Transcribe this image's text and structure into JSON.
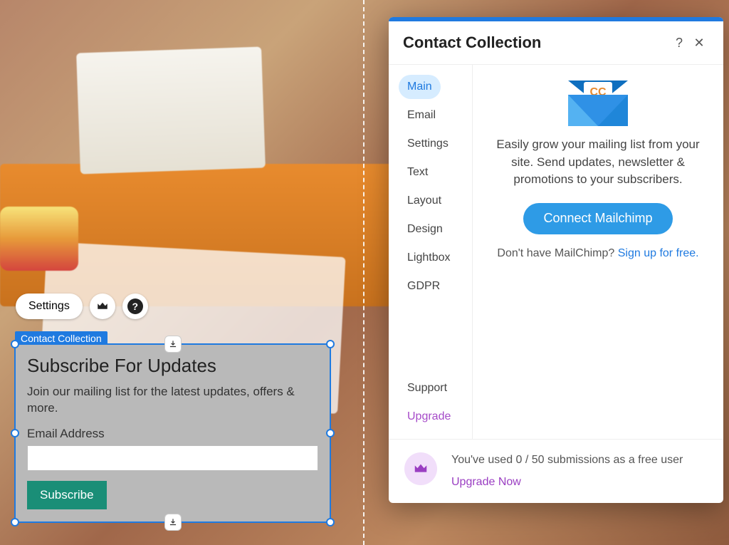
{
  "toolbar": {
    "settings_label": "Settings"
  },
  "widget": {
    "tag": "Contact Collection",
    "title": "Subscribe For Updates",
    "description": "Join our mailing list for the latest updates, offers & more.",
    "email_label": "Email Address",
    "email_value": "",
    "subscribe_label": "Subscribe"
  },
  "panel": {
    "title": "Contact Collection",
    "help_symbol": "?",
    "close_symbol": "✕",
    "sidebar": {
      "items": [
        {
          "label": "Main",
          "active": true
        },
        {
          "label": "Email"
        },
        {
          "label": "Settings"
        },
        {
          "label": "Text"
        },
        {
          "label": "Layout"
        },
        {
          "label": "Design"
        },
        {
          "label": "Lightbox"
        },
        {
          "label": "GDPR"
        }
      ],
      "support_label": "Support",
      "upgrade_label": "Upgrade"
    },
    "content": {
      "envelope_badge": "CC",
      "lead": "Easily grow your mailing list from your site. Send updates, newsletter & promotions to your subscribers.",
      "primary_button": "Connect Mailchimp",
      "signup_prefix": "Don't have MailChimp? ",
      "signup_link": "Sign up for free."
    },
    "footer": {
      "usage_text": "You've used 0 / 50 submissions as a free user",
      "upgrade_link": "Upgrade Now"
    }
  }
}
